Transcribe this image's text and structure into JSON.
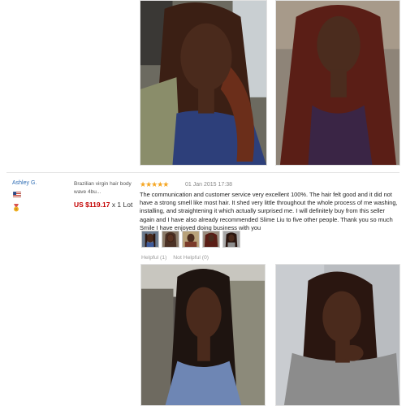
{
  "review": {
    "buyer_name": "Ashley G.",
    "country_flag_icon": "us-flag-icon",
    "badge_icon": "buyer-level-medal-icon",
    "product_name": "Brazilian virgin hair body wave 4bu...",
    "price": "US $119.17",
    "quantity": "x 1 Lot",
    "rating": 5,
    "stars": "★★★★★",
    "date": "01 Jan 2015 17:38",
    "text": "The communication and customer service very excellent 100%. The hair felt good and it did not have a strong smell like most hair. It shed very little throughout the whole process of me washing, installing, and straightening it which actually surprised me. I will definitely buy from this seller again and I have also already recommended Slime Liu to five other people. Thank you so much Smile I have enjoyed doing business with you",
    "helpful": "Helpful (1)",
    "not_helpful": "Not Helpful (0)",
    "thumbnail_count": 5
  },
  "colors": {
    "link": "#2e6db4",
    "price": "#c40000",
    "stars": "#f5a623"
  }
}
